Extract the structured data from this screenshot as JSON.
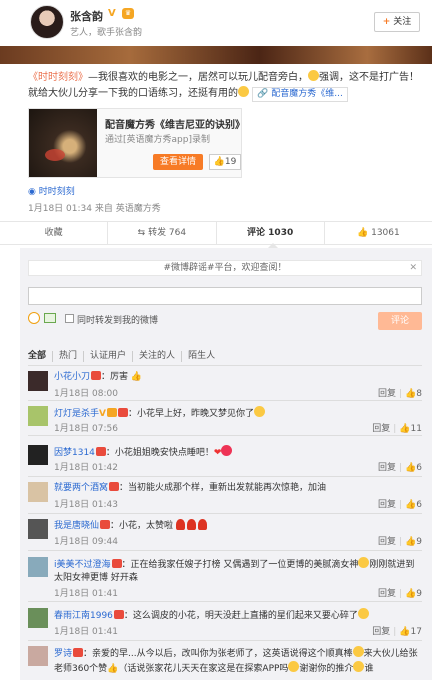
{
  "header": {
    "username": "张含韵",
    "verified_mark": "V",
    "bio": "艺人，歌手张含韵",
    "follow_label": "关注"
  },
  "post": {
    "text_1": "《时时刻刻》",
    "text_2": "—我很喜欢的电影之一，居然可以玩儿配音旁白，",
    "text_3": "强调，这不是打广告！就给大伙儿分享一下我的口语练习，还挺有用的",
    "tag_label": "配音魔方秀《维..."
  },
  "card": {
    "title": "配音魔方秀《维吉尼亚的诀别》",
    "subtitle": "通过[英语魔方秀app]录制",
    "button_label": "查看详情",
    "like_count": "19"
  },
  "source": {
    "location_label": "时时刻刻",
    "time_text": "1月18日 01:34 来自 英语魔方秀"
  },
  "actions": {
    "favorite": "收藏",
    "repost": "转发 764",
    "comment": "评论 1030",
    "like": "13061"
  },
  "comment_form": {
    "notice": "#微博辟谣#平台，欢迎查阅！",
    "close": "✕",
    "checkbox_label": "同时转发到我的微博",
    "submit_label": "评论"
  },
  "filters": [
    "全部",
    "热门",
    "认证用户",
    "关注的人",
    "陌生人"
  ],
  "reply_label": "回复",
  "comments": [
    {
      "user": "小花小刀",
      "text": "：厉害",
      "time": "1月18日 08:00",
      "likes": "8"
    },
    {
      "user": "灯灯是杀手",
      "text": "：小花早上好，昨晚又梦见你了",
      "time": "1月18日 07:56",
      "likes": "11"
    },
    {
      "user": "因梦1314",
      "text": "：小花姐姐晚安快点睡吧！",
      "time": "1月18日 01:42",
      "likes": "6"
    },
    {
      "user": "就要两个酒窝",
      "text": "：当初能火成那个样，重新出发就能再次惊艳，加油",
      "time": "1月18日 01:43",
      "likes": "6"
    },
    {
      "user": "我是唐晓仙",
      "text": "：小花，太赞啦",
      "time": "1月18日 09:44",
      "likes": "9"
    },
    {
      "user": "i美美不过澄海",
      "text": "：正在给我家任嫂子打榜 又偶遇到了一位更博的美腻滴女神",
      "text_2": "刚刚就进到太阳女神更博 好开森",
      "time": "1月18日 01:41",
      "likes": "9"
    },
    {
      "user": "春雨江南1996",
      "text": "：这么调皮的小花，明天没赶上直播的星们起来又要心碎了",
      "time": "1月18日 01:41",
      "likes": "17"
    },
    {
      "user": "罗诗",
      "text": "：亲爱的早...从今以后，改叫你为张老师了，这英语说得这个顺真棒",
      "text_2": "来大伙儿给张老师360个赞",
      "text_3": "（话说张家花儿天天在家这是在探索APP吗",
      "text_4": "谢谢你的推介",
      "text_5": "谁"
    }
  ]
}
